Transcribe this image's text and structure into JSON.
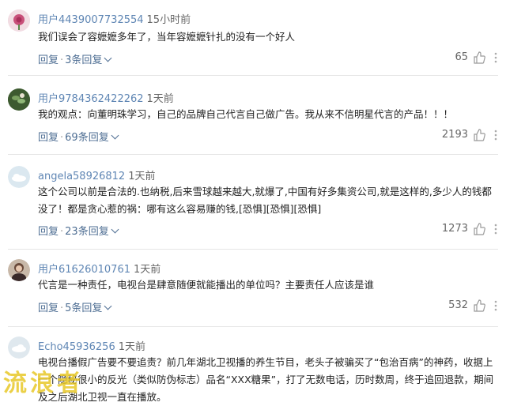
{
  "comments": [
    {
      "user": "用户4439007732554",
      "time": "15小时前",
      "text": "我们误会了容嬷嬷多年了，当年容嬷嬷针扎的没有一个好人",
      "reply_label": "回复",
      "sep": "·",
      "replies_label": "3条回复",
      "likes": "65",
      "avatar_color": "#c8507a"
    },
    {
      "user": "用户9784362422262",
      "time": "1天前",
      "text": "我的观点：向董明珠学习，自己的品牌自己代言自己做广告。我从来不信明星代言的产品！！！",
      "reply_label": "回复",
      "sep": "·",
      "replies_label": "69条回复",
      "likes": "2193",
      "avatar_color": "#4a6a3a"
    },
    {
      "user": "angela58926812",
      "time": "1天前",
      "text": "这个公司以前是合法的.也纳税,后来雪球越来越大,就爆了,中国有好多集资公司,就是这样的,多少人的钱都没了！都是贪心惹的祸：哪有这么容易赚的钱,[恐惧][恐惧][恐惧]",
      "reply_label": "回复",
      "sep": "·",
      "replies_label": "23条回复",
      "likes": "1273",
      "avatar_color": "#cfe0ea"
    },
    {
      "user": "用户61626010761",
      "time": "1天前",
      "text": "代言是一种责任，电视台是肆意随便就能播出的单位吗？主要责任人应该是谁",
      "reply_label": "回复",
      "sep": "·",
      "replies_label": "5条回复",
      "likes": "532",
      "avatar_color": "#7a5a4a"
    },
    {
      "user": "Echo45936256",
      "time": "1天前",
      "text": "电视台播假广告要不要追责？前几年湖北卫视播的养生节目，老头子被骗买了“包治百病”的神药，收据上一个隐秘很小的反光（类似防伪标志）品名“XXX糖果”，打了无数电话，历时数周，终于追回退款，期间及之后湖北卫视一直在播放。",
      "avatar_color": "#d8e4ec"
    }
  ],
  "watermark": "流浪者",
  "colors": {
    "username": "#5f86b4",
    "action": "#4e6e93",
    "watermark": "#e8c828"
  }
}
